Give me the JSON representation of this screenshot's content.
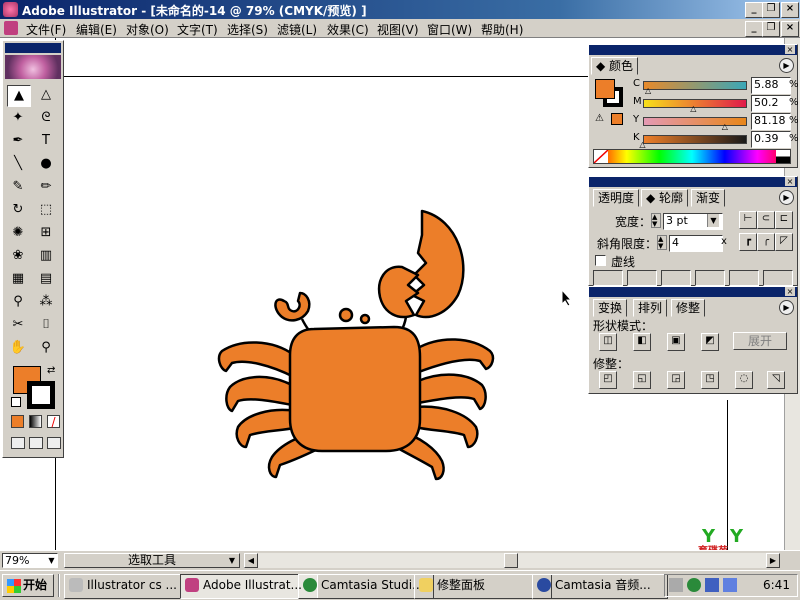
{
  "window": {
    "title": "Adobe Illustrator - [未命名的-14 @ 79% (CMYK/预览) ]"
  },
  "menu": [
    "文件(F)",
    "编辑(E)",
    "对象(O)",
    "文字(T)",
    "选择(S)",
    "滤镜(L)",
    "效果(C)",
    "视图(V)",
    "窗口(W)",
    "帮助(H)"
  ],
  "caption_buttons": [
    "_",
    "□",
    "×"
  ],
  "tools": [
    {
      "name": "selection-tool-icon",
      "glyph": "▲"
    },
    {
      "name": "direct-selection-tool-icon",
      "glyph": "△"
    },
    {
      "name": "magic-wand-tool-icon",
      "glyph": "✦"
    },
    {
      "name": "lasso-tool-icon",
      "glyph": "ᘓ"
    },
    {
      "name": "pen-tool-icon",
      "glyph": "✒"
    },
    {
      "name": "type-tool-icon",
      "glyph": "T"
    },
    {
      "name": "line-tool-icon",
      "glyph": "╲"
    },
    {
      "name": "ellipse-tool-icon",
      "glyph": "●"
    },
    {
      "name": "paintbrush-tool-icon",
      "glyph": "✎"
    },
    {
      "name": "pencil-tool-icon",
      "glyph": "✏"
    },
    {
      "name": "rotate-tool-icon",
      "glyph": "↻"
    },
    {
      "name": "scale-tool-icon",
      "glyph": "⬚"
    },
    {
      "name": "warp-tool-icon",
      "glyph": "✺"
    },
    {
      "name": "free-transform-tool-icon",
      "glyph": "⊞"
    },
    {
      "name": "symbol-sprayer-tool-icon",
      "glyph": "❀"
    },
    {
      "name": "graph-tool-icon",
      "glyph": "▥"
    },
    {
      "name": "mesh-tool-icon",
      "glyph": "▦"
    },
    {
      "name": "gradient-tool-icon",
      "glyph": "▤"
    },
    {
      "name": "eyedropper-tool-icon",
      "glyph": "⚲"
    },
    {
      "name": "blend-tool-icon",
      "glyph": "⁂"
    },
    {
      "name": "scissors-tool-icon",
      "glyph": "✂"
    },
    {
      "name": "slice-tool-icon",
      "glyph": "⌷"
    },
    {
      "name": "hand-tool-icon",
      "glyph": "✋"
    },
    {
      "name": "zoom-tool-icon",
      "glyph": "⚲"
    }
  ],
  "color_panel": {
    "tab": "颜色",
    "channels": [
      {
        "label": "C",
        "value": "5.88",
        "percent": 5.88,
        "gradient": "linear-gradient(90deg,#e88a2a,#3aa7b8)"
      },
      {
        "label": "M",
        "value": "50.2",
        "percent": 50.2,
        "gradient": "linear-gradient(90deg,#f7e01a,#e01a4a)"
      },
      {
        "label": "Y",
        "value": "81.18",
        "percent": 81.18,
        "gradient": "linear-gradient(90deg,#e49ab4,#e8861a)"
      },
      {
        "label": "K",
        "value": "0.39",
        "percent": 0.39,
        "gradient": "linear-gradient(90deg,#ee7f29,#1a1a1a)"
      }
    ],
    "percent_sign": "%",
    "fill_color": "#ec7e29"
  },
  "stroke_panel": {
    "tabs": [
      "透明度",
      "轮廓",
      "渐变"
    ],
    "weight_label": "宽度：",
    "weight_value": "3 pt",
    "miter_label": "斜角限度：",
    "miter_value": "4",
    "miter_unit": "x",
    "dashed_label": "虚线"
  },
  "pathfinder_panel": {
    "tabs": [
      "变换",
      "排列",
      "修整"
    ],
    "shape_modes_label": "形状模式：",
    "expand_button": "展开",
    "pathfinders_label": "修整："
  },
  "status": {
    "zoom": "79%",
    "tool": "选取工具"
  },
  "taskbar": {
    "start": "开始",
    "buttons": [
      "Illustrator cs ...",
      "Adobe Illustrat...",
      "Camtasia Studi...",
      "修整面板",
      "Camtasia 音频..."
    ],
    "clock": "6:41"
  },
  "watermark": "育碟苑",
  "colors": {
    "crab": "#ec7e29",
    "titlebar": "#0a246a"
  }
}
